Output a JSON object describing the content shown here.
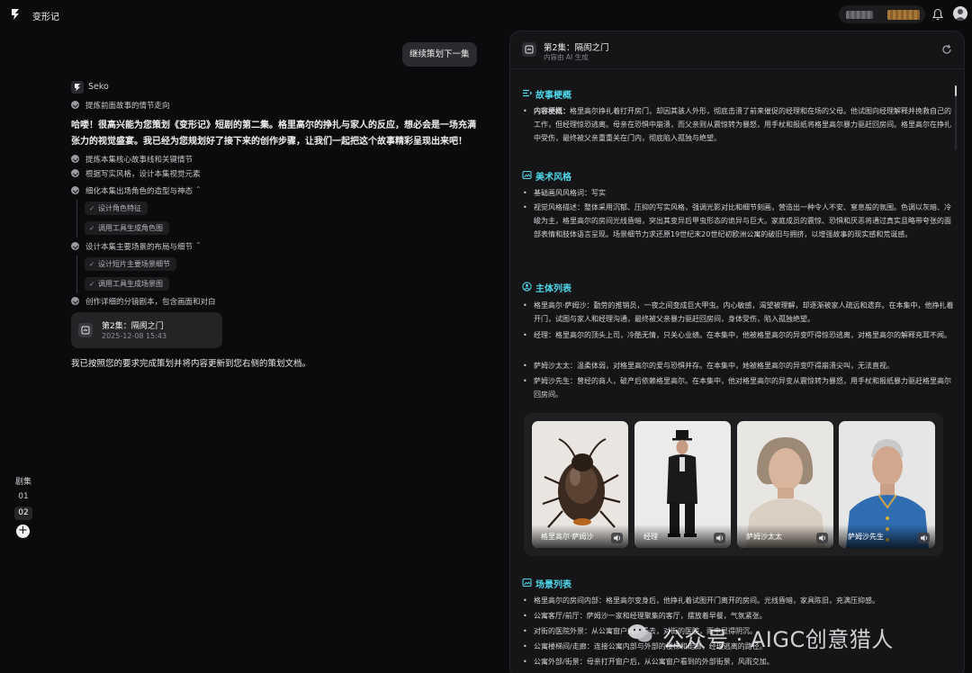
{
  "app": {
    "title": "变形记"
  },
  "rail": {
    "label": "剧集",
    "episodes": [
      "01",
      "02"
    ],
    "add": "+"
  },
  "chat": {
    "user_message": "继续策划下一集",
    "assistant_name": "Seko",
    "step0": "提炼前面故事的情节走向",
    "intro": "哈喽！很高兴能为您策划《变形记》短剧的第二集。格里高尔的挣扎与家人的反应，想必会是一场充满张力的视觉盛宴。我已经为您规划好了接下来的创作步骤，让我们一起把这个故事精彩呈现出来吧！",
    "steps": [
      "提炼本集核心故事线和关键情节",
      "根据写实风格，设计本集视觉元素",
      "细化本集出场角色的造型与神态",
      "设计本集主要场景的布局与细节",
      "创作详细的分镜剧本，包含画面和对白"
    ],
    "subtasks_a": [
      "设计角色特征",
      "调用工具生成角色图"
    ],
    "subtasks_b": [
      "设计短片主要场景细节",
      "调用工具生成场景图"
    ],
    "doc_card": {
      "title": "第2集：隔阂之门",
      "date": "2025-12-08 15:43"
    },
    "done": "我已按照您的要求完成策划并将内容更新到您右侧的策划文档。"
  },
  "panel": {
    "title": "第2集：隔阂之门",
    "subtitle": "内容由 AI 生成",
    "story": {
      "heading": "故事梗概",
      "label": "内容梗概：",
      "text": "格里高尔挣扎着打开房门，却因其骇人外形，彻底击溃了前来催促的经理和在场的父母。他试图向经理解释并挽救自己的工作，但经理惊恐逃离。母亲在恐惧中崩溃，而父亲则从震惊转为暴怒，用手杖和报纸将格里高尔暴力驱赶回房间。格里高尔在挣扎中受伤，最终被父亲重重关在门内，彻底陷入孤独与绝望。"
    },
    "art": {
      "heading": "美术风格",
      "items": [
        "基础画风风格词：写实",
        "视觉风格描述：整体采用沉郁、压抑的写实风格，强调光影对比和细节刻画，营造出一种令人不安、窒息般的氛围。色调以灰暗、冷峻为主，格里高尔的房间光线昏暗，突出其变异后甲虫形态的诡异与巨大。家庭成员的震惊、恐惧和厌恶将通过真实且略带夸张的面部表情和肢体语言呈现。场景细节力求还原19世纪末20世纪初欧洲公寓的破旧与拥挤，以增强故事的现实感和荒诞感。"
      ]
    },
    "cast": {
      "heading": "主体列表",
      "items": [
        "格里高尔·萨姆沙：勤劳的推销员，一夜之间变成巨大甲虫。内心敏感，渴望被理解，却逐渐被家人疏远和遗弃。在本集中，他挣扎着开门，试图与家人和经理沟通，最终被父亲暴力驱赶回房间，身体受伤，陷入孤独绝望。",
        "经理：格里高尔的顶头上司，冷酷无情，只关心业绩。在本集中，他被格里高尔的异变吓得惊恐逃离，对格里高尔的解释充耳不闻。",
        "萨姆沙太太：温柔体弱，对格里高尔的爱与恐惧并存。在本集中，她被格里高尔的异变吓得崩溃尖叫，无法直视。",
        "萨姆沙先生：曾经的商人，破产后依赖格里高尔。在本集中，他对格里高尔的异变从震惊转为暴怒，用手杖和报纸暴力驱赶格里高尔回房间。"
      ],
      "cards": [
        "格里高尔·萨姆沙",
        "经理",
        "萨姆沙太太",
        "萨姆沙先生"
      ]
    },
    "scenes": {
      "heading": "场景列表",
      "items": [
        "格里高尔的房间内部：格里高尔变身后，他挣扎着试图开门离开的房间。光线昏暗，家具陈旧，充满压抑感。",
        "公寓客厅/前厅：萨姆沙一家和经理聚集的客厅，摆放着早餐，气氛紧张。",
        "对街的医院外景：从公寓窗户向外看去，对街的医院，雨中显得阴沉。",
        "公寓楼梯间/走廊：连接公寓内部与外部的楼梯和走廊，经理逃离的路径。",
        "公寓外部/街景：母亲打开窗户后，从公寓窗户看到的外部街景，风雨交加。"
      ]
    }
  },
  "watermark": {
    "text": "公众号 · AIGC创意猎人"
  },
  "colors": {
    "accent": "#4fd6ea",
    "background": "#0b0b0d",
    "panel": "#151517"
  }
}
